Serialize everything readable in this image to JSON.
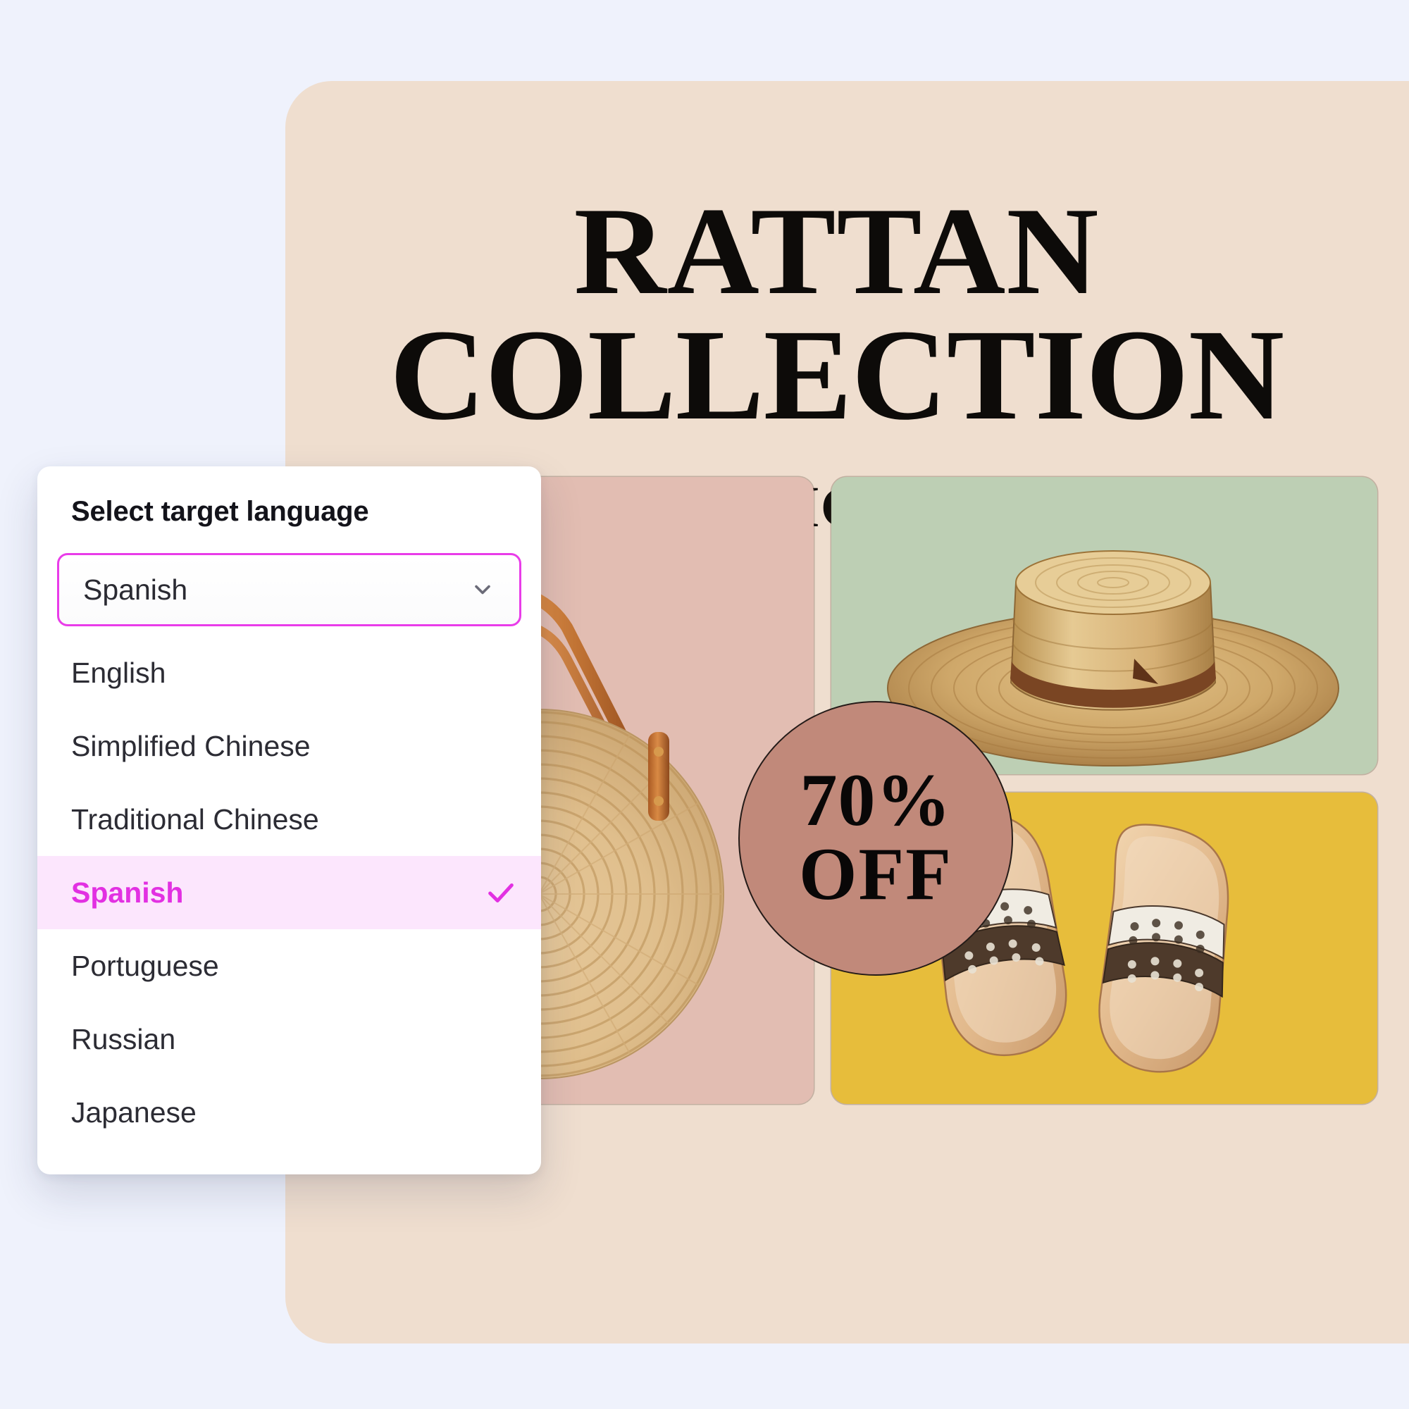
{
  "background_color": "#eff2fc",
  "poster": {
    "background_color": "#efdecf",
    "title_line1": "RATTAN",
    "title_line2": "COLLECTION",
    "handle": "@X-DESIGNSTORE",
    "badge": {
      "line1": "70%",
      "line2": "OFF",
      "color": "#c1897a"
    },
    "panels": [
      {
        "name": "panel-bag",
        "product": "woven-round-rattan-tote-bag",
        "background_color": "#e2bdb2"
      },
      {
        "name": "panel-hat",
        "product": "straw-sun-hat",
        "background_color": "#bdcfb4"
      },
      {
        "name": "panel-sandals",
        "product": "perforated-slide-sandals",
        "background_color": "#e7bd3b"
      }
    ]
  },
  "language_dialog": {
    "title": "Select target language",
    "selected_value": "Spanish",
    "chevron_icon": "chevron-down-icon",
    "check_icon": "check-icon",
    "accent_color": "#e93ce9",
    "highlight_background": "#fce6fd",
    "options": [
      {
        "label": "English",
        "selected": false
      },
      {
        "label": "Simplified Chinese",
        "selected": false
      },
      {
        "label": "Traditional Chinese",
        "selected": false
      },
      {
        "label": "Spanish",
        "selected": true
      },
      {
        "label": "Portuguese",
        "selected": false
      },
      {
        "label": "Russian",
        "selected": false
      },
      {
        "label": "Japanese",
        "selected": false
      }
    ]
  }
}
